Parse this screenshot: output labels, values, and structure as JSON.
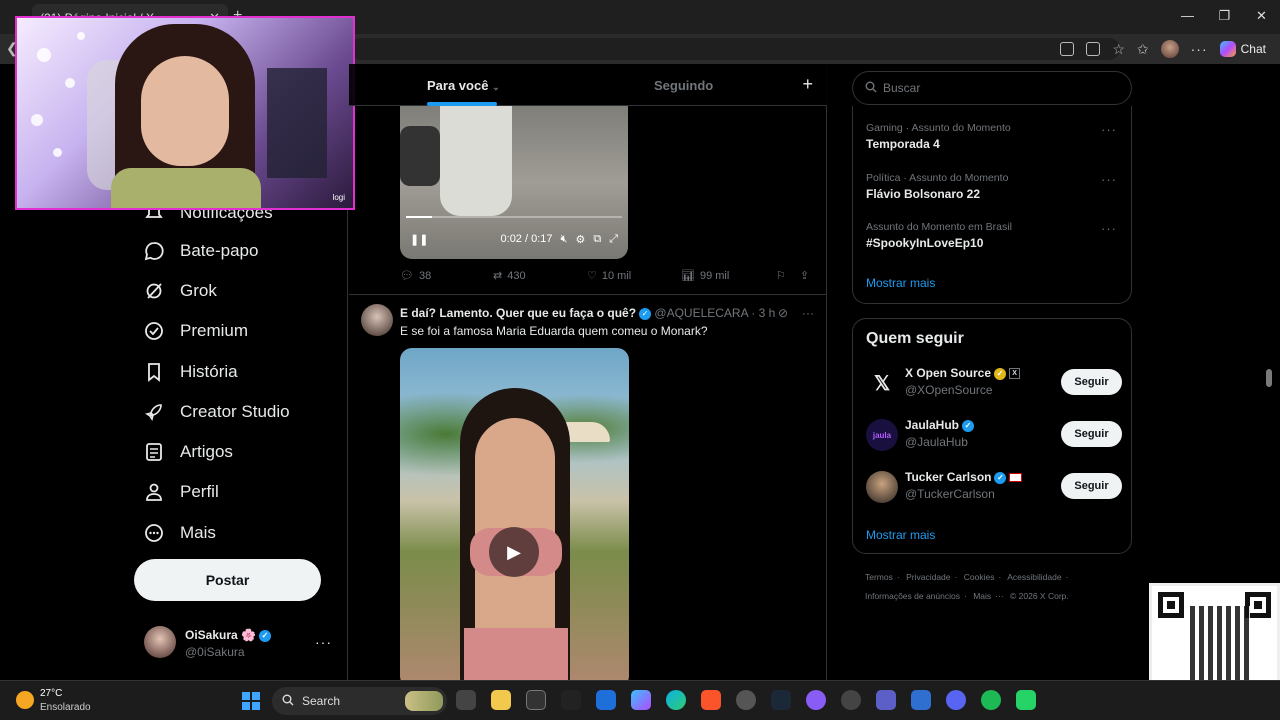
{
  "browser": {
    "tab_title": "(21) Página Inicial / X",
    "tab_close": "✕",
    "tab_add": "+",
    "chat_label": "Chat",
    "window_controls": [
      "—",
      "❐",
      "✕"
    ]
  },
  "nav": {
    "items": [
      {
        "label": "Notificações",
        "icon": "bell-icon"
      },
      {
        "label": "Bate-papo",
        "icon": "chat-bubble-icon"
      },
      {
        "label": "Grok",
        "icon": "grok-icon"
      },
      {
        "label": "Premium",
        "icon": "premium-badge-icon"
      },
      {
        "label": "História",
        "icon": "bookmark-icon"
      },
      {
        "label": "Creator Studio",
        "icon": "rocket-icon"
      },
      {
        "label": "Artigos",
        "icon": "article-icon"
      },
      {
        "label": "Perfil",
        "icon": "person-icon"
      },
      {
        "label": "Mais",
        "icon": "more-circle-icon"
      }
    ],
    "post_label": "Postar",
    "account": {
      "name": "OiSakura 🌸",
      "handle": "@0iSakura",
      "more": "···"
    }
  },
  "webcam": {
    "logo_text": "logi"
  },
  "feed": {
    "tabs": {
      "for_you": "Para você",
      "following": "Seguindo",
      "add": "+"
    },
    "tweet1": {
      "video_time": "0:02 / 0:17",
      "progress": 0.12,
      "actions": {
        "replies": "38",
        "retweets": "430",
        "likes": "10 mil",
        "views": "99 mil"
      }
    },
    "tweet2": {
      "name": "E daí? Lamento. Quer que eu faça o quê?",
      "handle": "@AQUELECARA",
      "time": "· 3 h",
      "text": "E se foi a famosa Maria Eduarda quem comeu o Monark?",
      "more": "···"
    }
  },
  "right": {
    "search_placeholder": "Buscar",
    "trends": [
      {
        "meta": "Gaming · Assunto do Momento",
        "topic": "Temporada 4"
      },
      {
        "meta": "Política · Assunto do Momento",
        "topic": "Flávio Bolsonaro 22"
      },
      {
        "meta": "Assunto do Momento em Brasil",
        "topic": "#SpookyInLoveEp10"
      }
    ],
    "trend_more": "···",
    "show_more": "Mostrar mais",
    "who_to_follow": {
      "title": "Quem seguir",
      "accounts": [
        {
          "name": "X Open Source",
          "handle": "@XOpenSource",
          "button": "Seguir",
          "badge": "X"
        },
        {
          "name": "JaulaHub",
          "handle": "@JaulaHub",
          "button": "Seguir",
          "badge": ""
        },
        {
          "name": "Tucker Carlson",
          "handle": "@TuckerCarlson",
          "button": "Seguir",
          "badge": ""
        }
      ],
      "show_more": "Mostrar mais"
    },
    "footer": [
      "Termos",
      "·",
      "Privacidade",
      "·",
      "Cookies",
      "·",
      "Acessibilidade",
      "·",
      "Informações de anúncios",
      "·",
      "Mais",
      "···",
      "© 2026 X Corp."
    ]
  },
  "taskbar": {
    "temperature": "27°C",
    "condition": "Ensolarado",
    "search_label": "Search"
  },
  "colors": {
    "accent": "#1d9bf0",
    "webcam_border": "#e12fd0",
    "gold_badge": "#e2b719"
  }
}
